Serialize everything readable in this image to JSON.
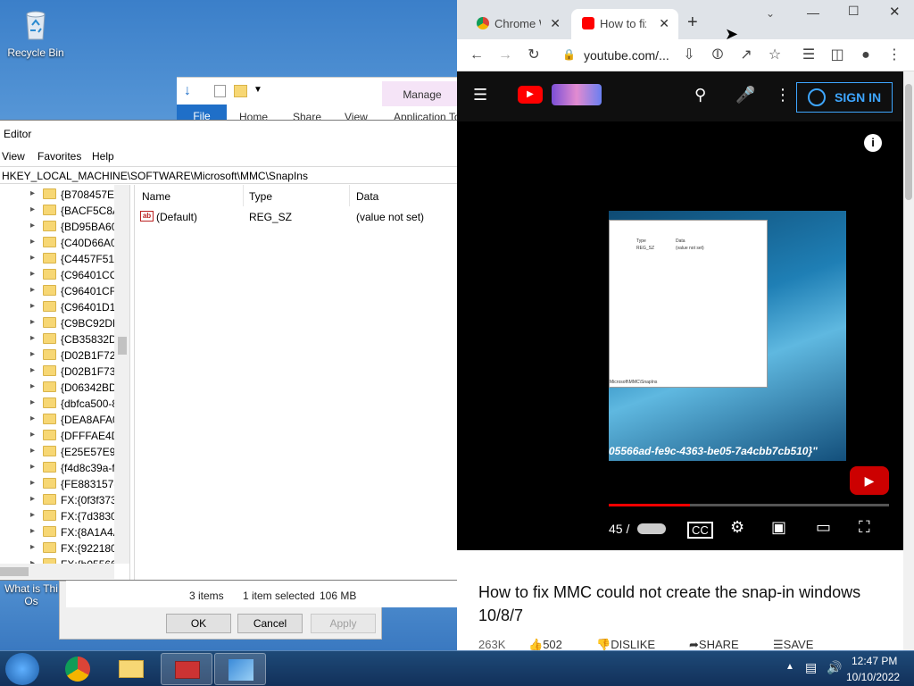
{
  "desktop": {
    "recycle_bin": "Recycle Bin",
    "partial_icon_line1": "What is Thi",
    "partial_icon_line2": "Os"
  },
  "explorer": {
    "file_tab": "File",
    "tabs": [
      "Home",
      "Share",
      "View",
      "Application To"
    ],
    "manage": "Manage"
  },
  "regedit": {
    "title": "Editor",
    "menu": [
      "View",
      "Favorites",
      "Help"
    ],
    "address": "HKEY_LOCAL_MACHINE\\SOFTWARE\\Microsoft\\MMC\\SnapIns",
    "tree_items": [
      "{B708457E-",
      "{BACF5C8A",
      "{BD95BA60",
      "{C40D66A0",
      "{C4457F51-",
      "{C96401CC",
      "{C96401CF-",
      "{C96401D1-",
      "{C9BC92DF",
      "{CB35832D",
      "{D02B1F72-",
      "{D02B1F73-",
      "{D06342BD-",
      "{dbfca500-8",
      "{DEA8AFA0",
      "{DFFFAE4D-",
      "{E25E57E9-I",
      "{f4d8c39a-f",
      "{FE883157-(",
      "FX:{0f3f373",
      "FX:{7d3830a",
      "FX:{8A1A4A",
      "FX:{922180c",
      "FX:{b05566"
    ],
    "columns": {
      "name": "Name",
      "type": "Type",
      "data": "Data"
    },
    "row": {
      "name": "(Default)",
      "type": "REG_SZ",
      "data": "(value not set)",
      "icon": "ab"
    }
  },
  "statusbar": {
    "items": "3 items",
    "selected": "1 item selected",
    "size": "106 MB"
  },
  "dialog": {
    "ok": "OK",
    "cancel": "Cancel",
    "apply": "Apply"
  },
  "chrome": {
    "tabs": [
      {
        "title": "Chrome W",
        "active": false
      },
      {
        "title": "How to fix",
        "active": true
      }
    ],
    "url": "youtube.com/...",
    "signin": "SIGN IN",
    "video_overlay": "05566ad-fe9c-4363-be05-7a4cbb7cb510}\"",
    "time": "45 /",
    "progress_fraction": 0.29,
    "video_title": "How to fix MMC could not create the snap-in windows 10/8/7",
    "views": "263K",
    "likes": "502",
    "dislike": "DISLIKE",
    "share": "SHARE",
    "save": "SAVE",
    "embedded": {
      "type_col": "Type",
      "data_col": "Data",
      "type_val": "REG_SZ",
      "data_val": "(value not set)",
      "address": "Microsoft\\MMC\\SnapIns"
    }
  },
  "taskbar": {
    "time": "12:47 PM",
    "date": "10/10/2022"
  },
  "colors": {
    "accent_blue": "#1f6fc8",
    "youtube_red": "#ff0000",
    "signin_blue": "#3ea6ff"
  }
}
